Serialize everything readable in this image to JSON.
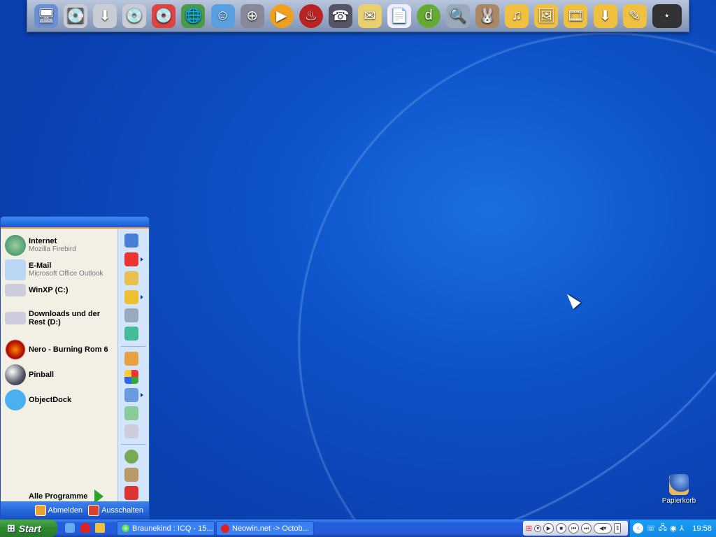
{
  "dock": {
    "icons": [
      "my-computer",
      "windows-xp-drive",
      "download-drive",
      "cd-drive",
      "burn-drive",
      "network-drive",
      "messenger",
      "browser",
      "media-player",
      "nero",
      "phone-book",
      "email",
      "document",
      "dreamweaver",
      "search",
      "emule",
      "music-folder",
      "pictures-folder",
      "videos-folder",
      "downloads-folder",
      "notes-folder",
      "tournament-logo"
    ]
  },
  "start_menu": {
    "pinned": [
      {
        "title": "Internet",
        "subtitle": "Mozilla Firebird"
      },
      {
        "title": "E-Mail",
        "subtitle": "Microsoft Office Outlook"
      }
    ],
    "items": [
      {
        "title": "WinXP (C:)"
      },
      {
        "title": "Downloads und der Rest (D:)"
      },
      {
        "title": "Nero - Burning Rom 6"
      },
      {
        "title": "Pinball"
      },
      {
        "title": "ObjectDock"
      }
    ],
    "all_programs": "Alle Programme",
    "logoff": "Abmelden",
    "shutdown": "Ausschalten"
  },
  "taskbar": {
    "start": "Start",
    "tasks": [
      {
        "label": "Braunekind : ICQ - 15..."
      },
      {
        "label": "Neowin.net -> Octob..."
      }
    ],
    "clock": "19:58"
  },
  "desktop": {
    "recycle_bin": "Papierkorb"
  }
}
